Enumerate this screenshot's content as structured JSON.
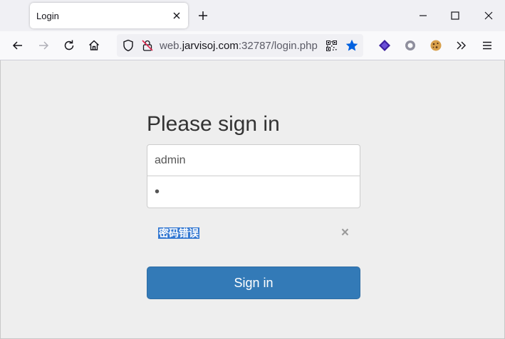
{
  "browser": {
    "tab_title": "Login",
    "url_prefix": "web.",
    "url_host": "jarvisoj.com",
    "url_suffix": ":32787/login.php"
  },
  "page": {
    "heading": "Please sign in",
    "username_value": "admin",
    "password_value": "•",
    "alert_text": "密码错误",
    "alert_close": "×",
    "signin_label": "Sign in"
  },
  "colors": {
    "primary_button": "#337ab7",
    "alert_highlight": "#3277d1",
    "bookmark_star": "#0060df",
    "page_background": "#eeeeee"
  },
  "icons": [
    "tab-close-icon",
    "new-tab-icon",
    "minimize-icon",
    "maximize-icon",
    "window-close-icon",
    "back-icon",
    "forward-icon",
    "reload-icon",
    "home-icon",
    "shield-icon",
    "insecure-lock-icon",
    "qr-code-icon",
    "bookmark-star-icon",
    "extension-layers-icon",
    "extension-circle-icon",
    "cookie-icon",
    "overflow-chevrons-icon",
    "menu-icon"
  ]
}
